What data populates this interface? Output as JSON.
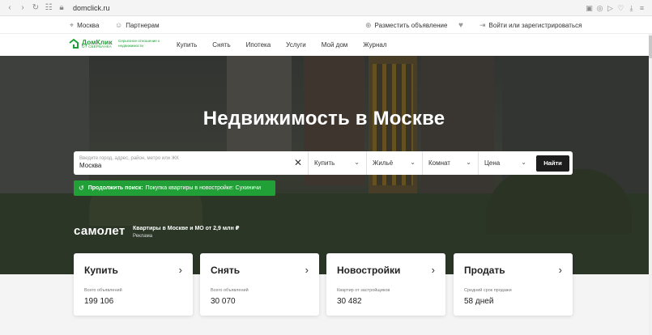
{
  "browser": {
    "url": "domclick.ru",
    "icons": [
      "back-icon",
      "forward-icon",
      "reload-icon",
      "apps-icon",
      "lock-icon"
    ],
    "right_icons": [
      "camera-icon",
      "shield-icon",
      "send-icon",
      "heart-icon",
      "download-icon",
      "menu-icon"
    ]
  },
  "topbar": {
    "city": "Москва",
    "partners": "Партнерам",
    "post_ad": "Разместить объявление",
    "login": "Войти или зарегистрироваться"
  },
  "logo": {
    "name": "ДомКлик",
    "sub": "ОТ СБЕРБАНКА",
    "tagline": "Серьезное отношение к недвижимости"
  },
  "nav": [
    "Купить",
    "Снять",
    "Ипотека",
    "Услуги",
    "Мой дом",
    "Журнал"
  ],
  "hero": {
    "title": "Недвижимость в Москве"
  },
  "search": {
    "placeholder": "Введите город, адрес, район, метро или ЖК",
    "value": "Москва",
    "deal_type": "Купить",
    "property_type": "Жильё",
    "rooms": "Комнат",
    "price": "Цена",
    "button": "Найти"
  },
  "continue_search": {
    "label": "Продолжить поиск:",
    "text": "Покупка квартиры в новостройке: Сухиничи"
  },
  "ad": {
    "brand": "самолет",
    "text": "Квартиры в Москве и МО от 2,9 млн ₽",
    "label": "Реклама"
  },
  "cards": [
    {
      "title": "Купить",
      "sub": "Всего объявлений",
      "value": "199 106"
    },
    {
      "title": "Снять",
      "sub": "Всего объявлений",
      "value": "30 070"
    },
    {
      "title": "Новостройки",
      "sub": "Квартир от застройщиков",
      "value": "30 482"
    },
    {
      "title": "Продать",
      "sub": "Средний срок продажи",
      "value": "58 дней"
    }
  ],
  "colors": {
    "brand_green": "#21a038",
    "button_dark": "#1d1d1d"
  }
}
